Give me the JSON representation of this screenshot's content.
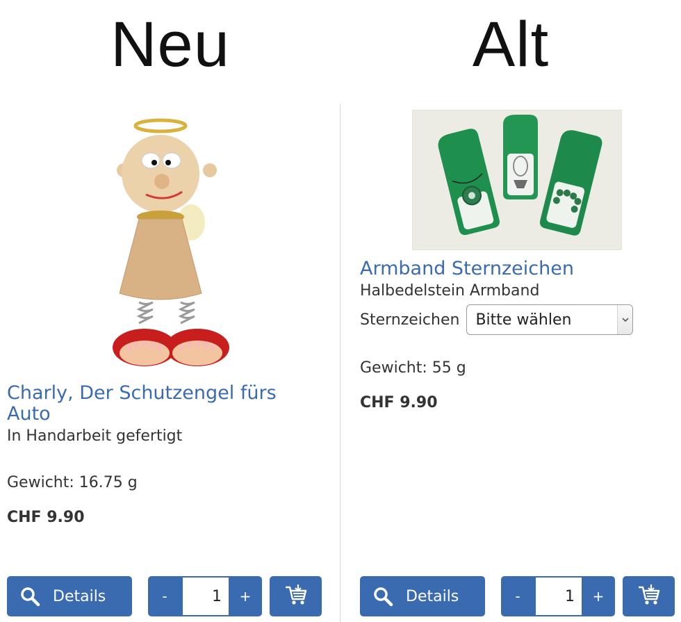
{
  "headings": {
    "left": "Neu",
    "right": "Alt"
  },
  "products": [
    {
      "title": "Charly, Der Schutzengel fürs Auto",
      "subtitle": "In Handarbeit gefertigt",
      "weight": "Gewicht: 16.75 g",
      "price": "CHF 9.90",
      "details_label": "Details",
      "qty_minus": "-",
      "qty_value": "1",
      "qty_plus": "+"
    },
    {
      "title": "Armband Sternzeichen",
      "subtitle": "Halbedelstein Armband",
      "variant_label": "Sternzeichen",
      "variant_value": "Bitte wählen",
      "weight": "Gewicht: 55 g",
      "price": "CHF 9.90",
      "details_label": "Details",
      "qty_minus": "-",
      "qty_value": "1",
      "qty_plus": "+"
    }
  ],
  "colors": {
    "accent": "#3a6bb0",
    "title": "#3a6bb0",
    "divider": "#d6d6d6"
  },
  "icons": {
    "details": "search-icon",
    "cart": "cart-add-icon",
    "select": "chevron-down-icon"
  }
}
